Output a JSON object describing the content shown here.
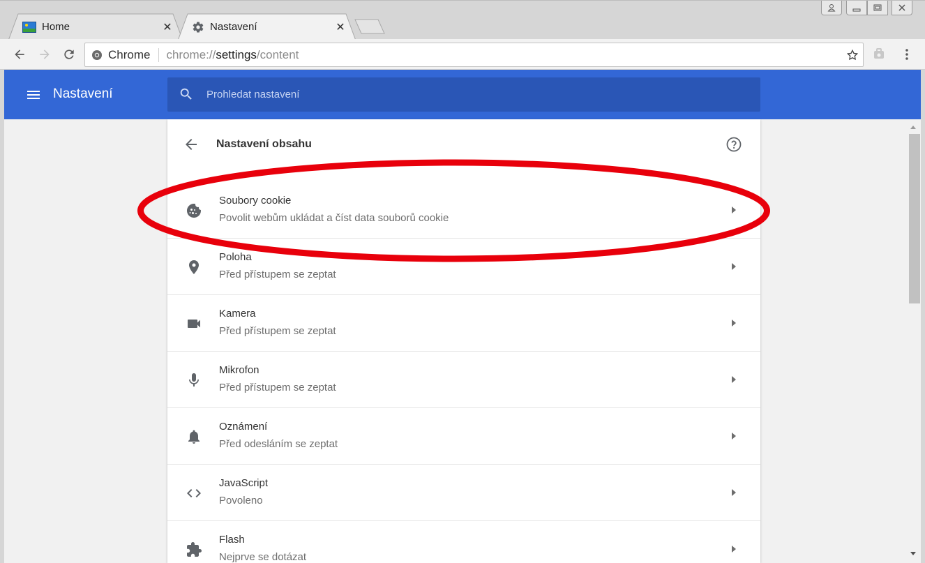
{
  "tabs": [
    {
      "title": "Home",
      "favicon": "landscape-icon"
    },
    {
      "title": "Nastavení",
      "favicon": "gear-icon"
    }
  ],
  "omnibox": {
    "chip_label": "Chrome",
    "url_scheme": "chrome://",
    "url_host": "settings",
    "url_path": "/content"
  },
  "header": {
    "title": "Nastavení",
    "search_placeholder": "Prohledat nastavení"
  },
  "card": {
    "title": "Nastavení obsahu",
    "items": [
      {
        "label": "Soubory cookie",
        "sub": "Povolit webům ukládat a číst data souborů cookie",
        "icon": "cookie-icon"
      },
      {
        "label": "Poloha",
        "sub": "Před přístupem se zeptat",
        "icon": "location-pin-icon"
      },
      {
        "label": "Kamera",
        "sub": "Před přístupem se zeptat",
        "icon": "camera-icon"
      },
      {
        "label": "Mikrofon",
        "sub": "Před přístupem se zeptat",
        "icon": "microphone-icon"
      },
      {
        "label": "Oznámení",
        "sub": "Před odesláním se zeptat",
        "icon": "bell-icon"
      },
      {
        "label": "JavaScript",
        "sub": "Povoleno",
        "icon": "code-icon"
      },
      {
        "label": "Flash",
        "sub": "Nejprve se dotázat",
        "icon": "puzzle-icon"
      }
    ]
  },
  "colors": {
    "header_bg": "#3367d6",
    "search_bg": "#2a56b6",
    "highlight": "#e8000b"
  }
}
